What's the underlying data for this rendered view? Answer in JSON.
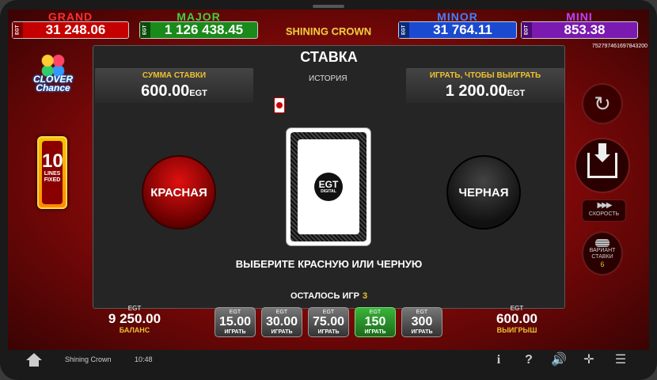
{
  "jackpots": [
    {
      "name": "GRAND",
      "value": "31 248.06",
      "title_color": "#ff3030",
      "bar_color": "#c40000",
      "currency": "EGT"
    },
    {
      "name": "MAJOR",
      "value": "1 126 438.45",
      "title_color": "#40d040",
      "bar_color": "#1a8a1a",
      "currency": "EGT"
    },
    {
      "name": "MINOR",
      "value": "31 764.11",
      "title_color": "#4080ff",
      "bar_color": "#1a4ad0",
      "currency": "EGT"
    },
    {
      "name": "MINI",
      "value": "853.38",
      "title_color": "#c040ff",
      "bar_color": "#7a1ab0",
      "currency": "EGT"
    }
  ],
  "game_logo": "SHINING CROWN",
  "ticket_id": "75279746169784320­0",
  "panel": {
    "title": "СТАВКА",
    "stake_label": "СУММА СТАВКИ",
    "stake_value": "600.00",
    "stake_currency": "EGT",
    "history_label": "ИСТОРИЯ",
    "win_label": "ИГРАТЬ, ЧТОБЫ ВЫИГРАТЬ",
    "win_value": "1 200.00",
    "win_currency": "EGT",
    "red_label": "КРАСНАЯ",
    "black_label": "ЧЕРНАЯ",
    "card_logo": "EGT",
    "card_logo_sub": "DIGITAL",
    "choose_text": "ВЫБЕРИТЕ КРАСНУЮ ИЛИ ЧЕРНУЮ",
    "remaining_label": "ОСТАЛОСЬ ИГР",
    "remaining_count": "3"
  },
  "left": {
    "clover_logo": "CLOVER Chance",
    "lines_number": "10",
    "lines_text": "LINES FIXED"
  },
  "right": {
    "speed_label": "СКОРОСТЬ",
    "variant_label": "ВАРИАНТ СТАВКИ",
    "variant_number": "6"
  },
  "bottom": {
    "balance_currency": "EGT",
    "balance_value": "9 250.00",
    "balance_label": "БАЛАНС",
    "win_currency": "EGT",
    "win_value": "600.00",
    "win_label": "ВЫИГРЫШ",
    "bets": [
      {
        "currency": "EGT",
        "value": "15.00",
        "label": "ИГРАТЬ"
      },
      {
        "currency": "EGT",
        "value": "30.00",
        "label": "ИГРАТЬ"
      },
      {
        "currency": "EGT",
        "value": "75.00",
        "label": "ИГРАТЬ"
      },
      {
        "currency": "EGT",
        "value": "150",
        "label": "ИГРАТЬ",
        "active": true
      },
      {
        "currency": "EGT",
        "value": "300",
        "label": "ИГРАТЬ"
      }
    ]
  },
  "status": {
    "game_name": "Shining Crown",
    "time": "10:48"
  },
  "icons": {
    "home": "home-icon",
    "info": "info-icon",
    "help": "help-icon",
    "sound": "sound-icon",
    "fullscreen": "exit-fullscreen-icon",
    "menu": "menu-icon",
    "reset": "refresh-icon",
    "collect": "collect-icon",
    "speed": "fast-forward-icon",
    "variant": "coin-stack-icon"
  }
}
